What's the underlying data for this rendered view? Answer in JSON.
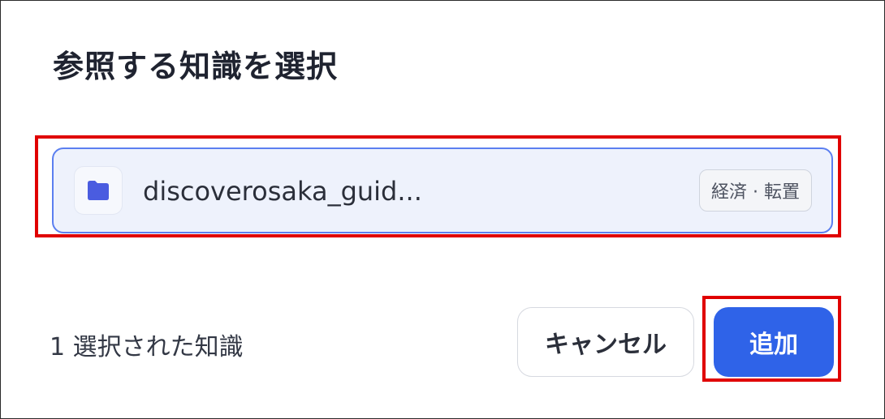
{
  "dialog": {
    "title": "参照する知識を選択",
    "item": {
      "icon": "folder-icon",
      "name": "discoverosaka_guid...",
      "tag": "経済 · 転置"
    },
    "footer": {
      "selected_text": "1 選択された知識",
      "cancel_label": "キャンセル",
      "add_label": "追加"
    }
  },
  "colors": {
    "accent": "#2f63e8",
    "item_border": "#5b7ff0",
    "item_bg": "#eef2fc",
    "annotation_red": "#e00000"
  }
}
